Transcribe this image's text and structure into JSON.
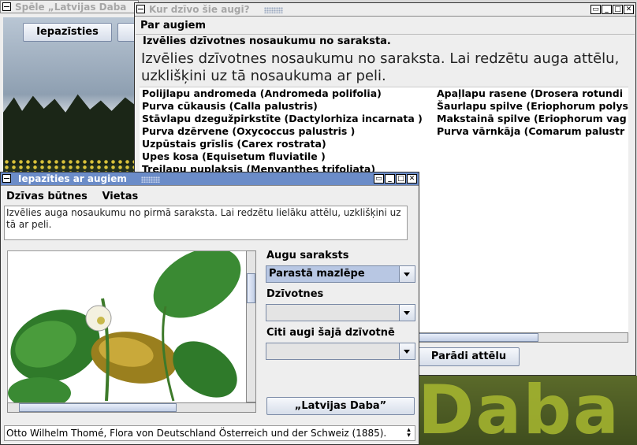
{
  "back_window": {
    "title": "Spēle „Latvijas Daba",
    "button_recognize": "Iepazīsties",
    "watermark": "Daba"
  },
  "plants_window": {
    "title": "Kur dzīvo šie augi?",
    "menu": [
      "Par augiem"
    ],
    "hint_small": "Izvēlies dzīvotnes nosaukumu no saraksta.",
    "hint_large": "Izvēlies dzīvotnes nosaukumu no saraksta. Lai redzētu auga attēlu, uzklišķini uz tā nosaukuma ar peli.",
    "list_left": [
      "Polijlapu andromeda (Andromeda polifolia)",
      "Purva cūkausis (Calla palustris)",
      "Stāvlapu dzegužpirkstīte (Dactylorhiza incarnata )",
      "Purva dzērvene (Oxycoccus palustris )",
      "Uzpūstais grīslis (Carex rostrata)",
      "Upes kosa (Equisetum fluviatile )",
      "Trejlapu puplaksis (Menyanthes trifoliata)"
    ],
    "list_right": [
      "Apaļlapu rasene (Drosera rotundi",
      "Šaurlapu spilve (Eriophorum polys",
      "Makstainā spilve (Eriophorum vag",
      "Purva vārnkāja (Comarum palustr"
    ],
    "show_image_button": "Parādi attēlu"
  },
  "plants_intro_window": {
    "title": "Iepazīties ar augiem",
    "menu": [
      "Dzīvas būtnes",
      "Vietas"
    ],
    "instructions": "Izvēlies auga nosaukumu no pirmā saraksta. Lai redzētu lielāku attēlu, uzklišķini uz tā ar peli.",
    "plant_list_label": "Augu saraksts",
    "plant_list_selected": "Parastā mazlēpe",
    "habitats_label": "Dzīvotnes",
    "habitats_selected": "",
    "other_plants_label": "Citi augi šajā dzīvotnē",
    "other_plants_selected": "",
    "latvijas_daba_button": "„Latvijas Daba”",
    "caption": "Otto Wilhelm Thomé, Flora von Deutschland Österreich und der Schweiz (1885)."
  },
  "colors": {
    "active_title": "#6b8cc8",
    "selected_combo": "#b8c7e3",
    "leaf_green": "#2f7a2a"
  }
}
